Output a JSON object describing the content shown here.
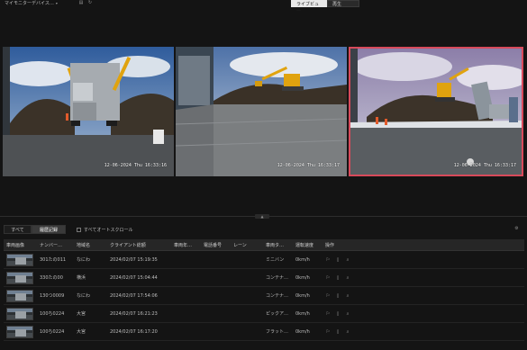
{
  "topbar": {
    "site_label": "マイモニターデバイス…",
    "chevron_icon": "chevron-down-icon",
    "icons": [
      "list-icon",
      "refresh-icon"
    ],
    "view_modes": [
      {
        "label": "ライブビュー",
        "active": true
      },
      {
        "label": "再生",
        "active": false
      }
    ]
  },
  "cameras": [
    {
      "timestamp": "12-06-2024 Thu 16:33:16",
      "overlay": "",
      "selected": false
    },
    {
      "timestamp": "12-06-2024 Thu 16:33:17",
      "overlay": "",
      "selected": false
    },
    {
      "timestamp": "12-06-2024 Thu 16:33:17",
      "overlay": "",
      "selected": true
    }
  ],
  "filter": {
    "tabs": [
      {
        "label": "すべて",
        "active": false
      },
      {
        "label": "履歴記録",
        "active": true
      }
    ],
    "auto_scroll_label": "すべてオートスクロール"
  },
  "table": {
    "headers": [
      "車両画像",
      "ナンバー…",
      "地域名",
      "クライアント総額",
      "車両年…",
      "電話番号",
      "レーン",
      "車両タ…",
      "運転速度",
      "操作"
    ],
    "rows": [
      {
        "plate": "301たの011",
        "region": "なにわ",
        "client": "2024/02/07 15:19:35",
        "type": "",
        "phone": "",
        "lane": "",
        "vtype": "ミニバン",
        "speed": "0km/h"
      },
      {
        "plate": "330たの00",
        "region": "横浜",
        "client": "2024/02/07 15:04:44",
        "type": "",
        "phone": "",
        "lane": "",
        "vtype": "コンテナ…",
        "speed": "0km/h"
      },
      {
        "plate": "130つ0009",
        "region": "なにわ",
        "client": "2024/02/07 17:54:06",
        "type": "",
        "phone": "",
        "lane": "",
        "vtype": "コンテナ…",
        "speed": "0km/h"
      },
      {
        "plate": "100ち0224",
        "region": "大宮",
        "client": "2024/02/07 16:21:23",
        "type": "",
        "phone": "",
        "lane": "",
        "vtype": "ピックア…",
        "speed": "0km/h"
      },
      {
        "plate": "100ち0224",
        "region": "大宮",
        "client": "2024/02/07 16:17:20",
        "type": "",
        "phone": "",
        "lane": "",
        "vtype": "フラット…",
        "speed": "0km/h"
      }
    ],
    "row_actions": [
      "flag-icon",
      "document-icon",
      "search-icon"
    ]
  },
  "colors": {
    "background": "#141414",
    "selected_border": "#d84a5b",
    "active_toggle": "#e8e8e8"
  }
}
